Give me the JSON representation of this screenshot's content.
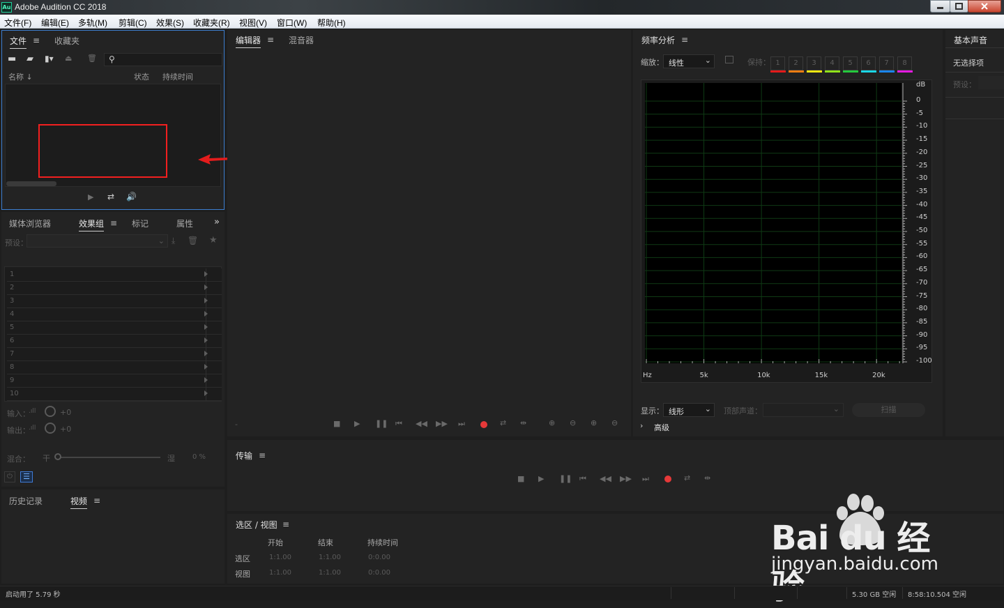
{
  "window": {
    "title": "Adobe Audition CC 2018",
    "logo": "Au"
  },
  "menubar": [
    "文件(F)",
    "编辑(E)",
    "多轨(M)",
    "剪辑(C)",
    "效果(S)",
    "收藏夹(R)",
    "视图(V)",
    "窗口(W)",
    "帮助(H)"
  ],
  "files_panel": {
    "tabs": [
      "文件",
      "收藏夹"
    ],
    "columns": {
      "name": "名称",
      "status": "状态",
      "duration": "持续时间"
    }
  },
  "effects_panel": {
    "tabs": [
      "媒体浏览器",
      "效果组",
      "标记",
      "属性"
    ],
    "preset_label": "预设：",
    "rows": [
      "1",
      "2",
      "3",
      "4",
      "5",
      "6",
      "7",
      "8",
      "9",
      "10"
    ],
    "input_label": "输入：",
    "output_label": "输出：",
    "input_value": "+0",
    "output_value": "+0",
    "mix_label": "混合：",
    "dry_label": "干",
    "wet_label": "湿",
    "mix_value": "0 %"
  },
  "history_panel": {
    "tabs": [
      "历史记录",
      "视频"
    ]
  },
  "editor_panel": {
    "tabs": [
      "编辑器",
      "混音器"
    ],
    "dash": "-"
  },
  "transport_panel": {
    "title": "传输"
  },
  "selection_panel": {
    "title": "选区 / 视图",
    "headers": [
      "开始",
      "结束",
      "持续时间"
    ],
    "rows": [
      {
        "label": "选区",
        "start": "1:1.00",
        "end": "1:1.00",
        "dur": "0:0.00"
      },
      {
        "label": "视图",
        "start": "1:1.00",
        "end": "1:1.00",
        "dur": "0:0.00"
      }
    ]
  },
  "freq_panel": {
    "title": "频率分析",
    "zoom_label": "缩放：",
    "zoom_value": "线性",
    "hold_label": "保持：",
    "channels": [
      "1",
      "2",
      "3",
      "4",
      "5",
      "6",
      "7",
      "8"
    ],
    "channel_colors": [
      "#e41a1a",
      "#f07d12",
      "#f2e811",
      "#8fe21a",
      "#24c93d",
      "#1ad6e6",
      "#1a85f0",
      "#e41ae0"
    ],
    "y_unit": "dB",
    "y_ticks": [
      "0",
      "-5",
      "-10",
      "-15",
      "-20",
      "-25",
      "-30",
      "-35",
      "-40",
      "-45",
      "-50",
      "-55",
      "-60",
      "-65",
      "-70",
      "-75",
      "-80",
      "-85",
      "-90",
      "-95",
      "-100"
    ],
    "x_unit": "Hz",
    "x_ticks": [
      "5k",
      "10k",
      "15k",
      "20k"
    ],
    "display_label": "显示：",
    "display_value": "线形",
    "top_channel_label": "顶部声道：",
    "scan_button": "扫描",
    "advanced_label": "高级"
  },
  "essential_panel": {
    "title": "基本声音",
    "no_selection": "无选择项",
    "preset_label": "预设："
  },
  "statusbar": {
    "left": "启动用了 5.79 秒",
    "disk": "5.30 GB 空闲",
    "time": "8:58:10.504 空闲"
  },
  "watermark": {
    "brand": "Bai du 经验",
    "url": "jingyan.baidu.com"
  }
}
